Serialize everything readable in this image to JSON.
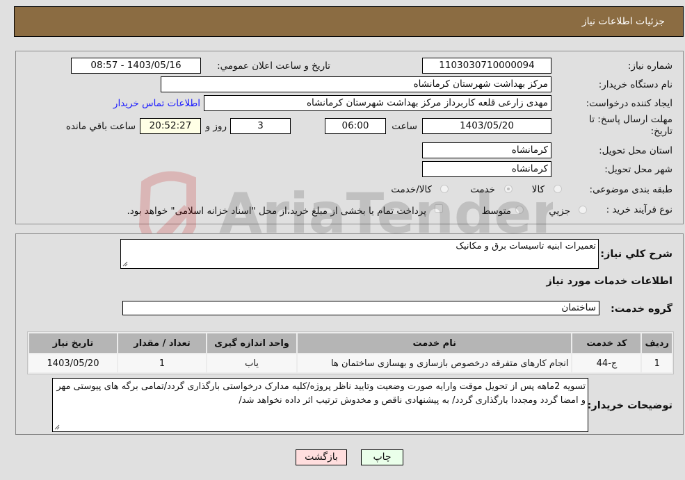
{
  "header": {
    "title": "جزئيات اطلاعات نياز"
  },
  "form": {
    "need_number": {
      "label": "شماره نياز:",
      "value": "1103030710000094"
    },
    "announce_datetime": {
      "label": "تاريخ و ساعت اعلان عمومي:",
      "value": "1403/05/16 - 08:57"
    },
    "buyer_org": {
      "label": "نام دستگاه خريدار:",
      "value": "مرکز بهداشت شهرستان کرمانشاه"
    },
    "requester": {
      "label": "ايجاد کننده درخواست:",
      "value": "مهدی  زارعی قلعه کاربرداز مرکز بهداشت شهرستان کرمانشاه"
    },
    "buyer_contact_link": "اطلاعات تماس خريدار",
    "deadline": {
      "label": "مهلت ارسال پاسخ: تا تاريخ:",
      "date": "1403/05/20",
      "time_label": "ساعت",
      "time": "06:00",
      "days": "3",
      "days_label": "روز و",
      "remaining": "20:52:27",
      "remaining_label": "ساعت باقي مانده"
    },
    "delivery_province": {
      "label": "استان محل تحويل:",
      "value": "کرمانشاه"
    },
    "delivery_city": {
      "label": "شهر محل تحويل:",
      "value": "کرمانشاه"
    },
    "category": {
      "label": "طبقه بندی موضوعی:",
      "options": [
        "کالا",
        "خدمت",
        "کالا/خدمت"
      ],
      "selected": "خدمت"
    },
    "purchase_process": {
      "label": "نوع فرآيند خريد :",
      "options": [
        "جزيي",
        "متوسط"
      ],
      "selected": "جزيي",
      "treasury_note": "پرداخت تمام يا بخشی از مبلغ خريد،از محل \"اسناد خزانه اسلامی\" خواهد بود."
    }
  },
  "details": {
    "general_desc": {
      "label": "شرح كلي نياز:",
      "value": "تعميرات ابنيه تاسيسات برق و مکانيک"
    },
    "services_title": "اطلاعات خدمات مورد نياز",
    "service_group": {
      "label": "گروه خدمت:",
      "value": "ساختمان"
    },
    "table": {
      "headers": [
        "رديف",
        "کد خدمت",
        "نام خدمت",
        "واحد اندازه گيری",
        "تعداد / مقدار",
        "تاريخ نياز"
      ],
      "rows": [
        [
          "1",
          "ج-44",
          "انجام کارهای متفرقه درخصوص بازسازی و بهسازی ساختمان ها",
          "ياب",
          "1",
          "1403/05/20"
        ]
      ]
    },
    "buyer_notes": {
      "label": "توضيحات خريدار:",
      "value": "تسویه 2ماهه پس از تحویل موقت وارایه صورت وضعیت وتایید ناظر پروژه/کلیه مدارک درخواستی بارگذاری گردد/تمامی برگه های پیوستی مهر و امضا گردد ومجددا بارگذاری گردد/ به پیشنهادی ناقص و مخدوش ترتیب اثر داده نخواهد شد/"
    }
  },
  "buttons": {
    "print": "چاپ",
    "back": "بازگشت"
  },
  "colors": {
    "header_bg": "#8b6c42",
    "print_bg": "#eaffea",
    "back_bg": "#ffdede",
    "link": "#1a1aff"
  },
  "watermark": "AriaTender.neT"
}
